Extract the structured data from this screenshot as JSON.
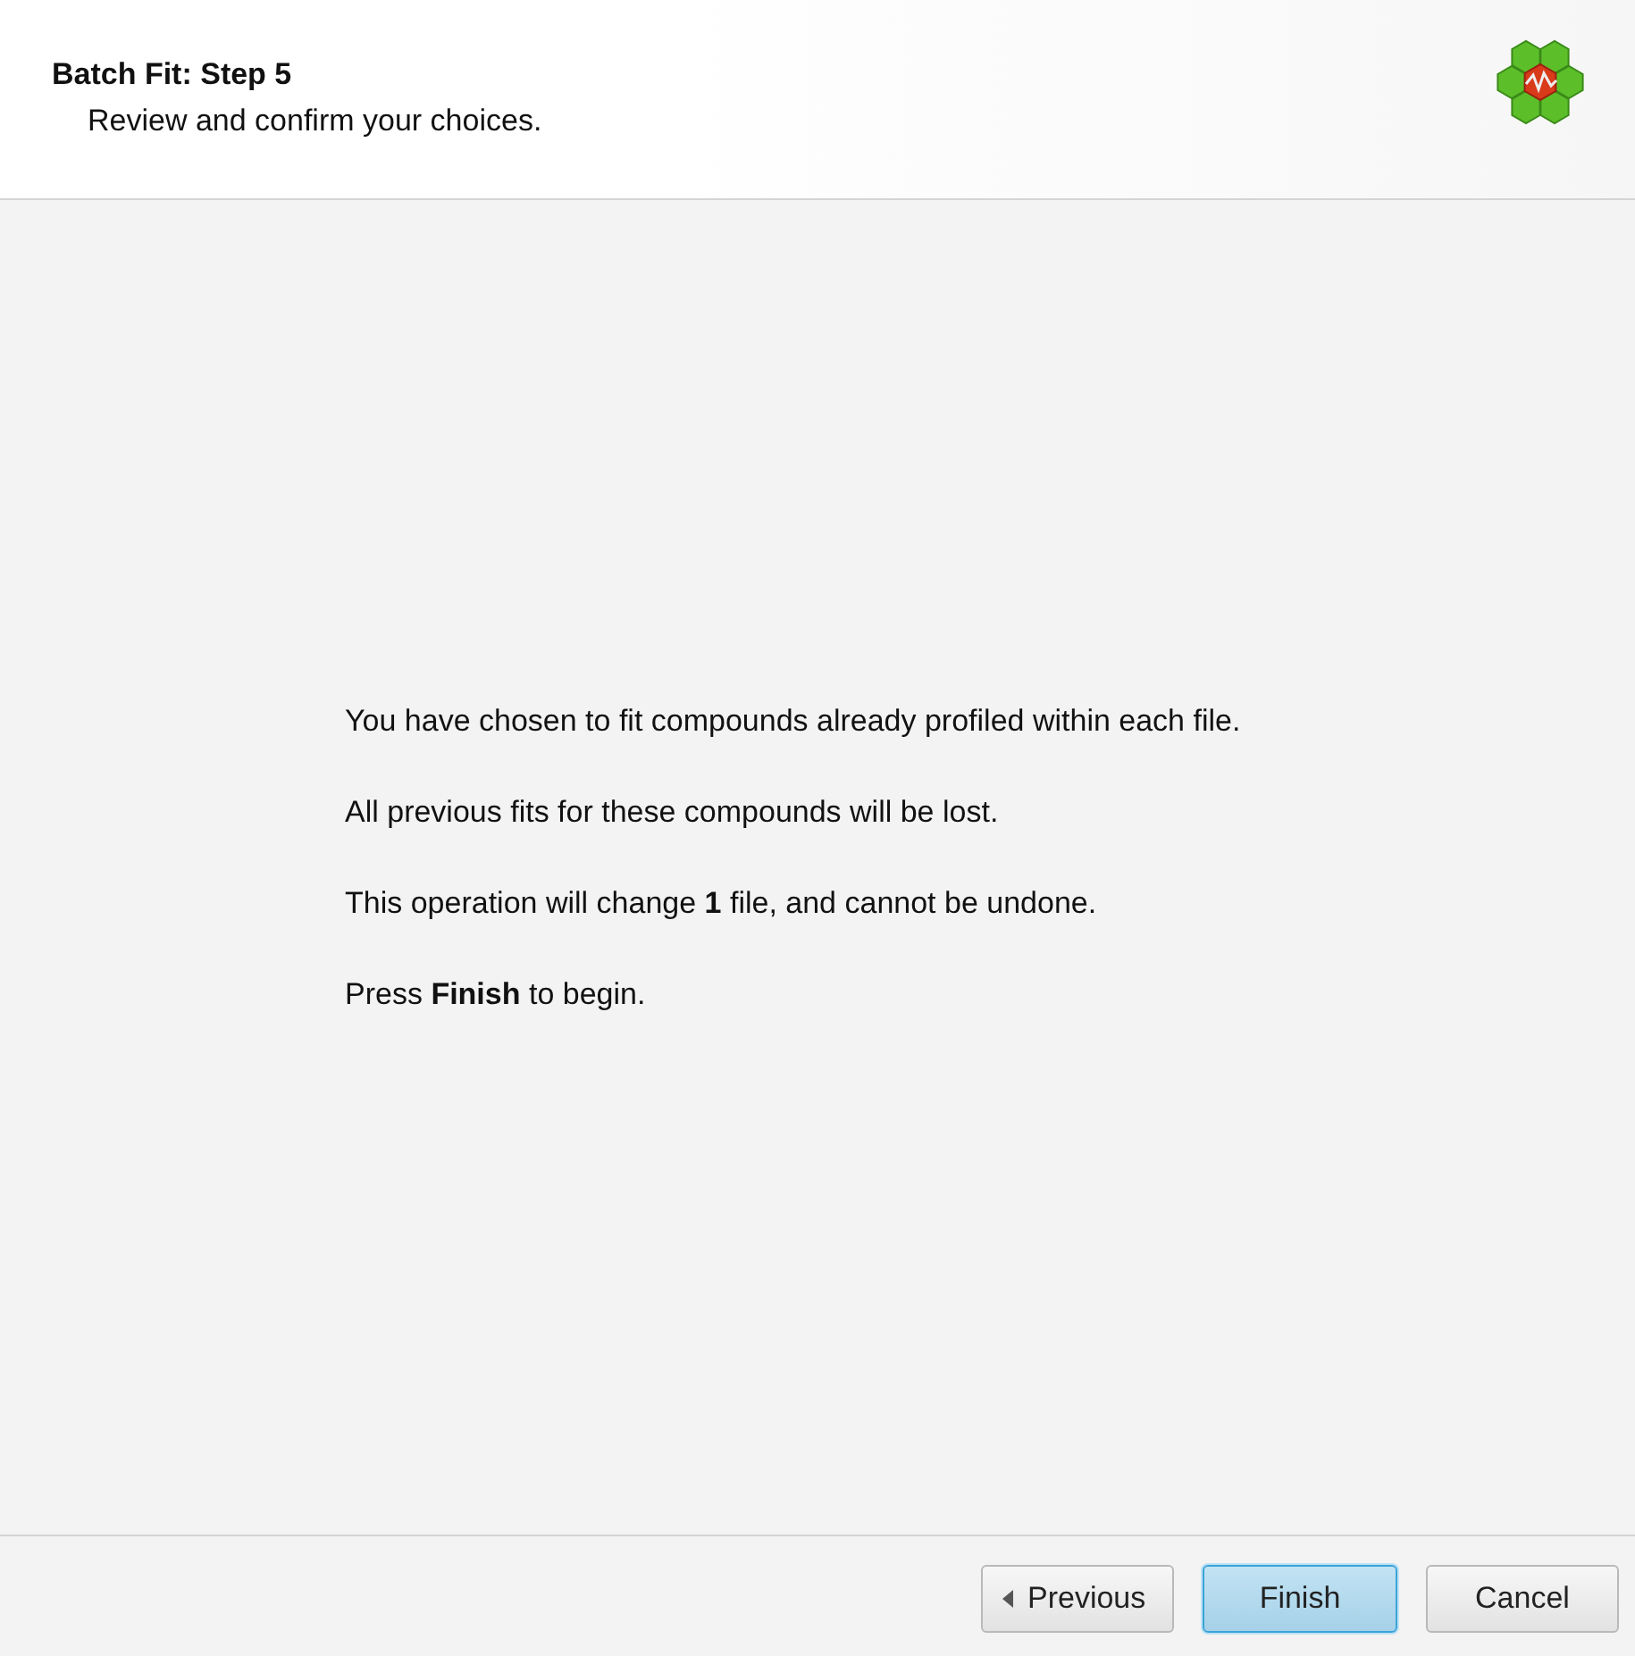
{
  "header": {
    "title": "Batch Fit: Step 5",
    "subtitle": "Review and confirm your choices."
  },
  "messages": [
    "You have chosen to fit compounds already profiled within each file.",
    "All previous fits for these compounds will be lost.",
    "This operation will change **1** file, and cannot be undone.",
    "Press **Finish** to begin."
  ],
  "buttons": [
    {
      "label": "Previous",
      "kind": "back"
    },
    {
      "label": "Finish",
      "kind": "default"
    },
    {
      "label": "Cancel",
      "kind": "normal"
    }
  ]
}
